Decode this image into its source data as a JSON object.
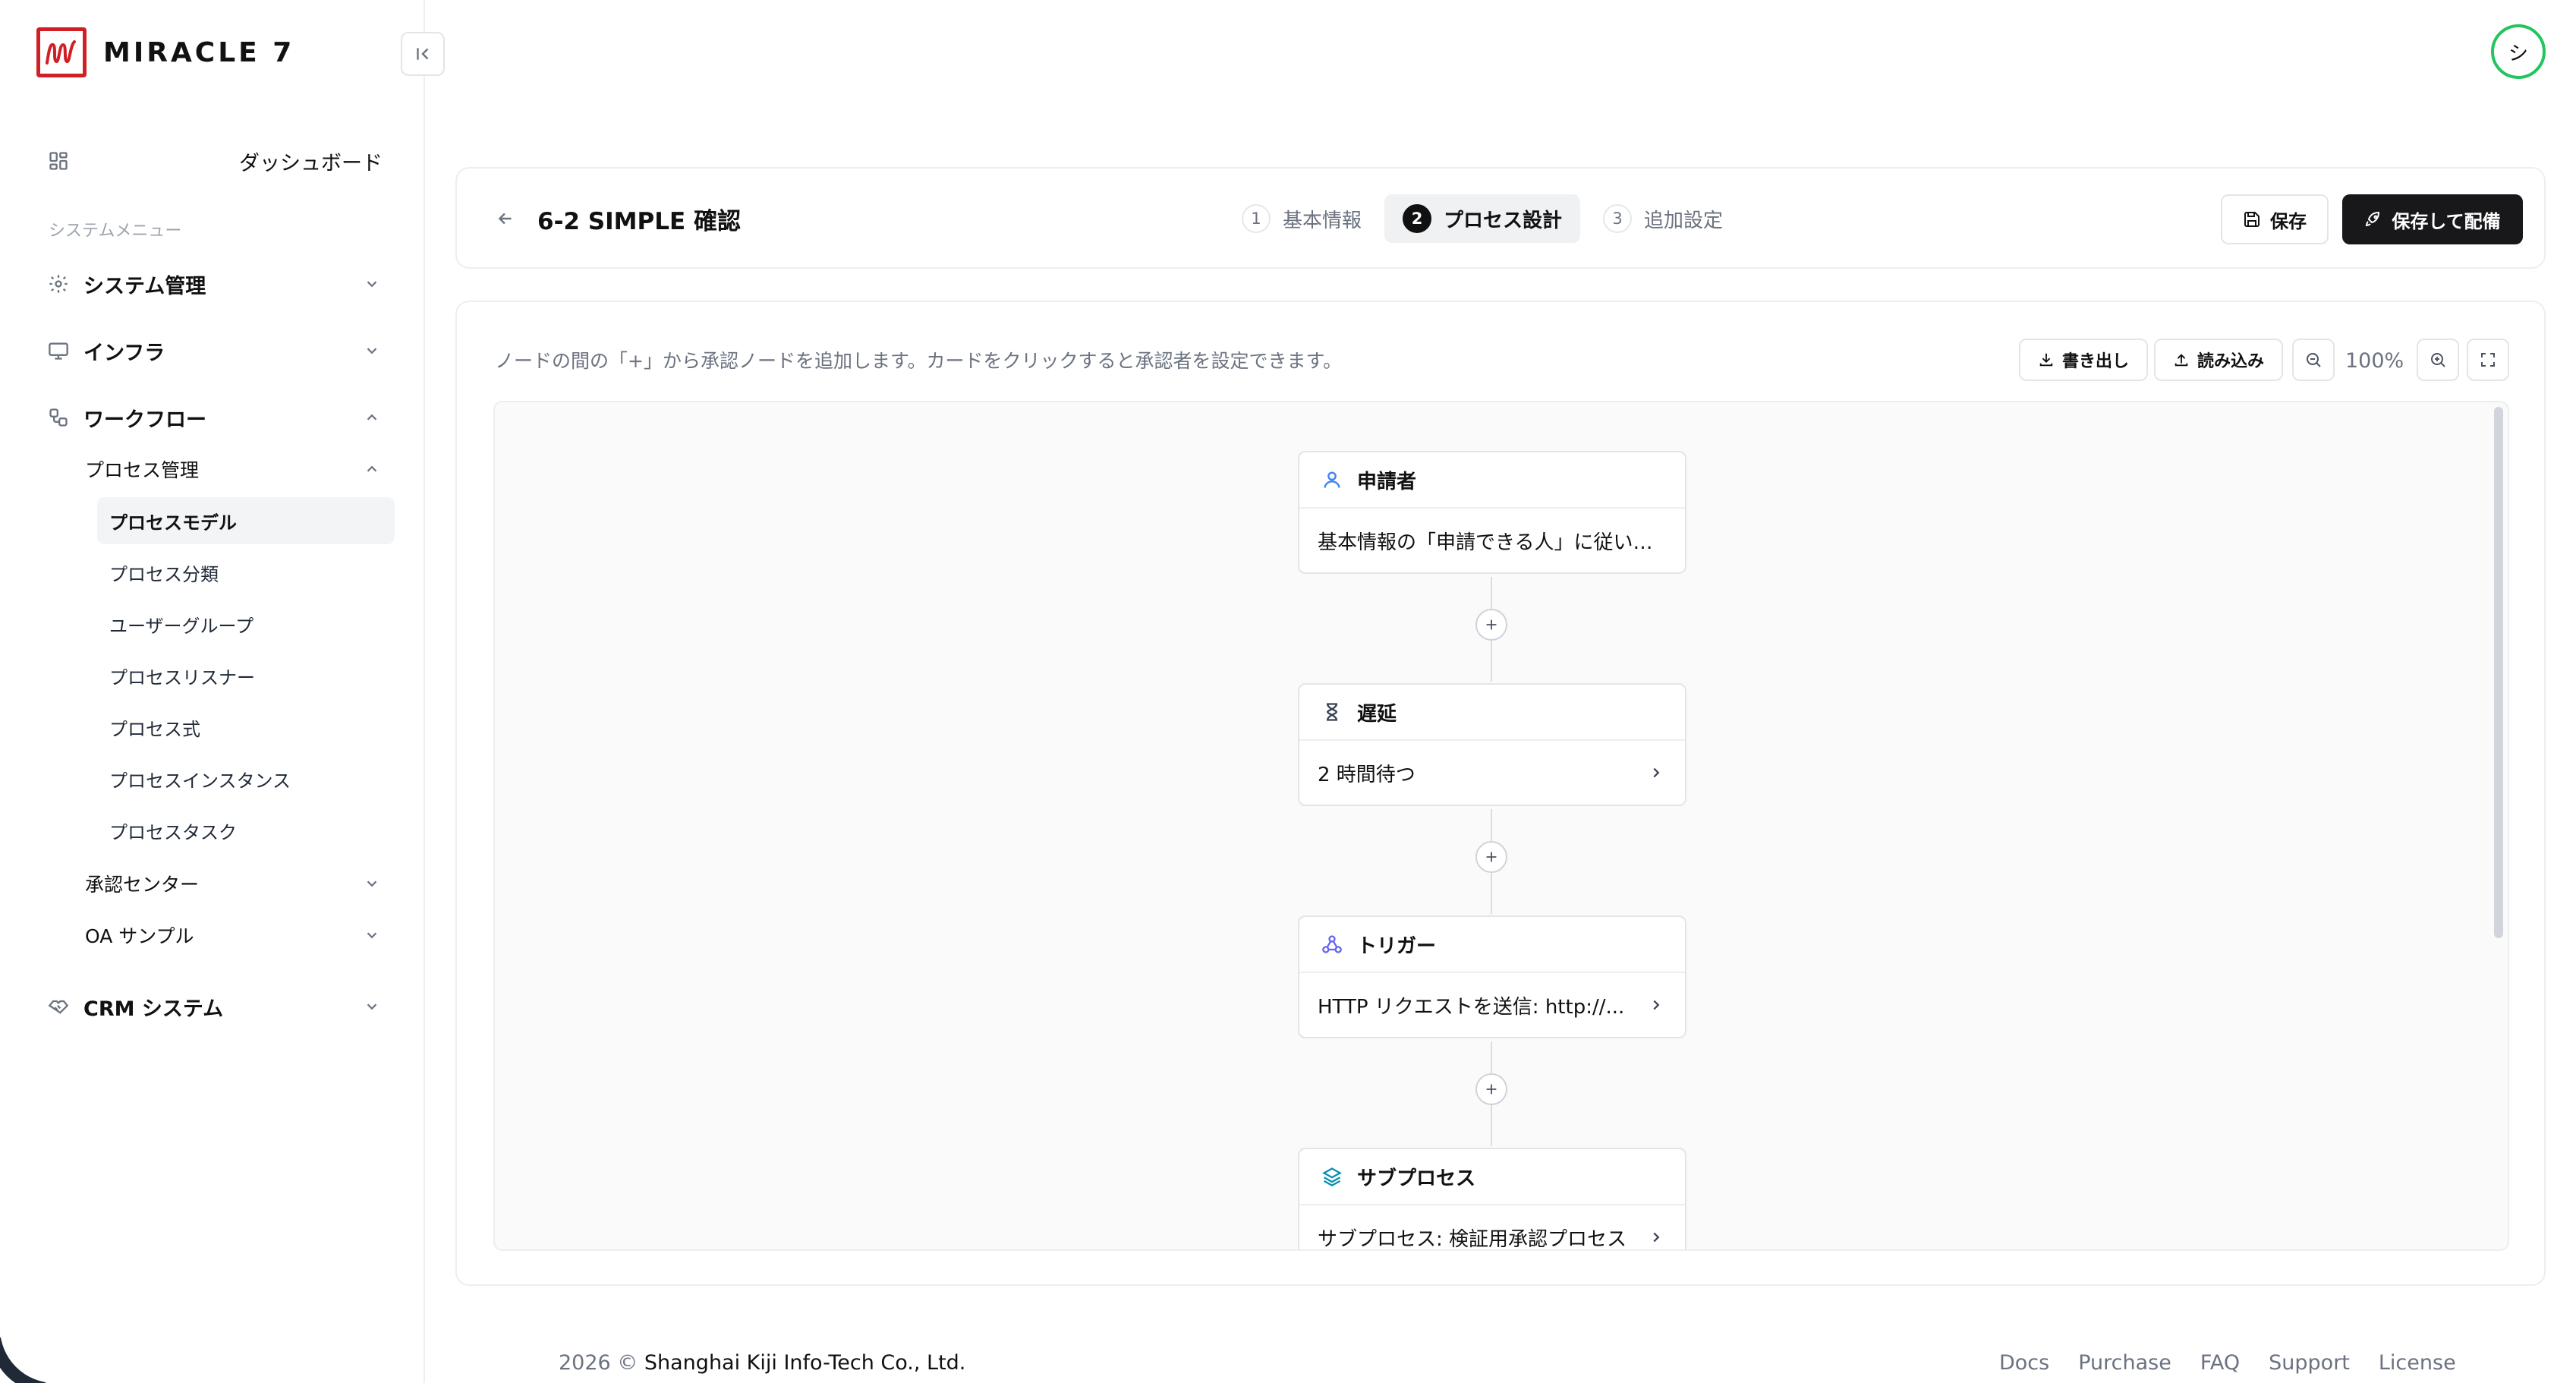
{
  "brand": {
    "name": "MIRACLE 7"
  },
  "user": {
    "avatar_initial": "シ"
  },
  "sidebar": {
    "dashboard": "ダッシュボード",
    "section_label": "システムメニュー",
    "system_admin": "システム管理",
    "infra": "インフラ",
    "workflow": "ワークフロー",
    "process_mgmt": "プロセス管理",
    "leaves": [
      "プロセスモデル",
      "プロセス分類",
      "ユーザーグループ",
      "プロセスリスナー",
      "プロセス式",
      "プロセスインスタンス",
      "プロセスタスク"
    ],
    "approval_center": "承認センター",
    "oa_sample": "OA サンプル",
    "crm": "CRM システム"
  },
  "header": {
    "title": "6-2 SIMPLE 確認",
    "steps": [
      {
        "num": "1",
        "label": "基本情報"
      },
      {
        "num": "2",
        "label": "プロセス設計"
      },
      {
        "num": "3",
        "label": "追加設定"
      }
    ],
    "save_label": "保存",
    "deploy_label": "保存して配備"
  },
  "designer": {
    "hint": "ノードの間の「+」から承認ノードを追加します。カードをクリックすると承認者を設定できます。",
    "export_label": "書き出し",
    "import_label": "読み込み",
    "zoom": "100%",
    "nodes": [
      {
        "title": "申請者",
        "body": "基本情報の「申請できる人」に従い…"
      },
      {
        "title": "遅延",
        "body": "2 時間待つ"
      },
      {
        "title": "トリガー",
        "body": "HTTP リクエストを送信: http://..."
      },
      {
        "title": "サブプロセス",
        "body": "サブプロセス: 検証用承認プロセス"
      }
    ]
  },
  "footer": {
    "year": "2026 ©",
    "company": "Shanghai Kiji Info-Tech Co., Ltd.",
    "links": [
      "Docs",
      "Purchase",
      "FAQ",
      "Support",
      "License"
    ]
  },
  "colors": {
    "brand_red": "#d11f26",
    "avatar_ring": "#22c55e",
    "primary_dark": "#18181b",
    "applicant_icon": "#3b82f6",
    "trigger_icon": "#6366f1",
    "subprocess_icon": "#0891b2"
  }
}
